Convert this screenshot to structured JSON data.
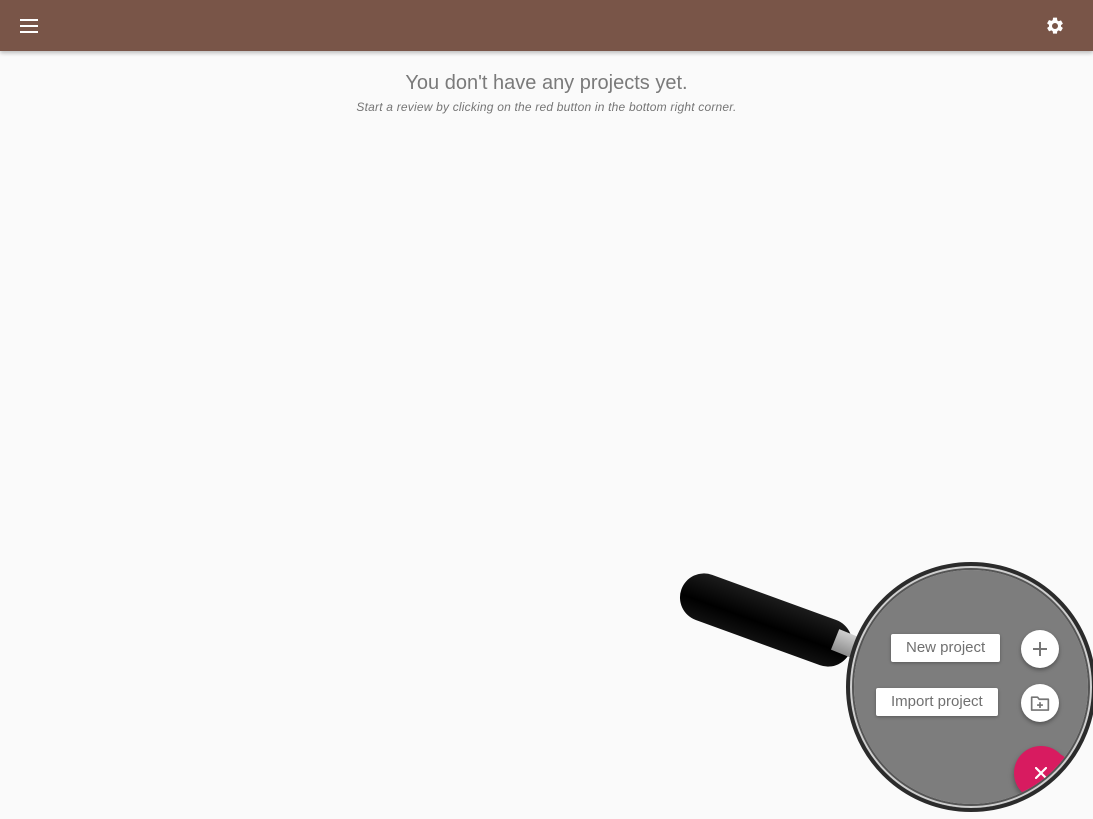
{
  "appbar": {
    "background": "#795548",
    "menu_icon": "menu-icon",
    "settings_icon": "gear-icon"
  },
  "empty_state": {
    "title": "You don't have any projects yet.",
    "subtitle": "Start a review by clicking on the red button in the bottom right corner."
  },
  "speed_dial": {
    "actions": [
      {
        "label": "New project",
        "icon": "plus-icon"
      },
      {
        "label": "Import project",
        "icon": "folder-plus-icon"
      }
    ],
    "fab_icon": "close-icon",
    "fab_color": "#d81b60"
  },
  "overlay": {
    "type": "magnifier",
    "lens_color": "#7d7d7d"
  }
}
